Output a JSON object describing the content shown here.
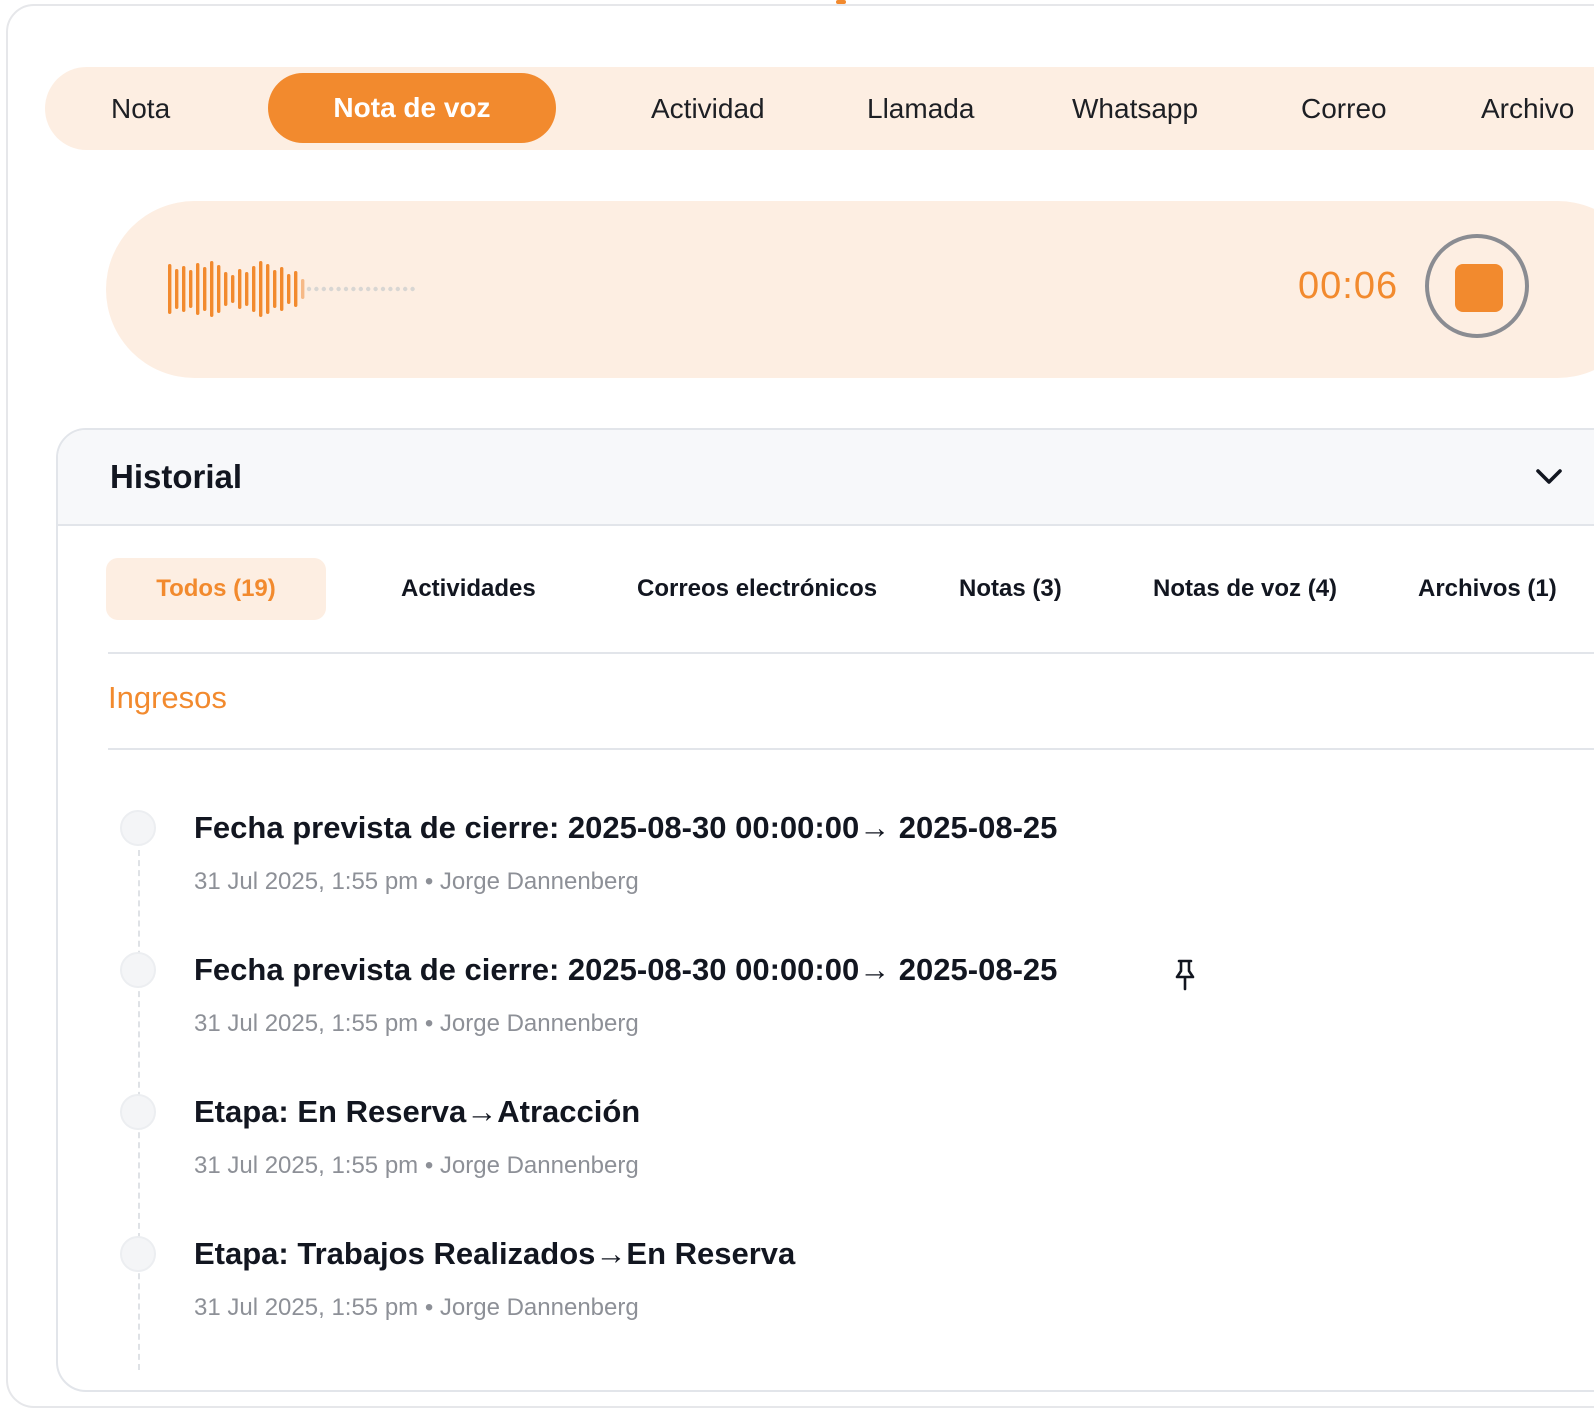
{
  "composer": {
    "tabs": [
      {
        "label": "Nota"
      },
      {
        "label": "Nota de voz"
      },
      {
        "label": "Actividad"
      },
      {
        "label": "Llamada"
      },
      {
        "label": "Whatsapp"
      },
      {
        "label": "Correo"
      },
      {
        "label": "Archivo"
      }
    ],
    "active_tab": "Nota de voz"
  },
  "recorder": {
    "timer": "00:06",
    "colors": {
      "accent": "#f28a2e",
      "background": "#fdeee2",
      "pending": "#d8d6d3"
    }
  },
  "historial": {
    "title": "Historial",
    "filters": [
      {
        "label": "Todos (19)"
      },
      {
        "label": "Actividades"
      },
      {
        "label": "Correos electrónicos"
      },
      {
        "label": "Notas (3)"
      },
      {
        "label": "Notas de voz (4)"
      },
      {
        "label": "Archivos (1)"
      }
    ],
    "active_filter": "Todos (19)",
    "section": "Ingresos",
    "entries": [
      {
        "title": "Fecha prevista de cierre: 2025-08-30 00:00:00→ 2025-08-25",
        "meta": "31 Jul 2025, 1:55 pm • Jorge Dannenberg",
        "pinned": false
      },
      {
        "title": "Fecha prevista de cierre: 2025-08-30 00:00:00→ 2025-08-25",
        "meta": "31 Jul 2025, 1:55 pm • Jorge Dannenberg",
        "pinned": true
      },
      {
        "title": "Etapa: En Reserva→Atracción",
        "meta": "31 Jul 2025, 1:55 pm • Jorge Dannenberg",
        "pinned": false
      },
      {
        "title": "Etapa: Trabajos Realizados→En Reserva",
        "meta": "31 Jul 2025, 1:55 pm • Jorge Dannenberg",
        "pinned": false
      }
    ]
  }
}
